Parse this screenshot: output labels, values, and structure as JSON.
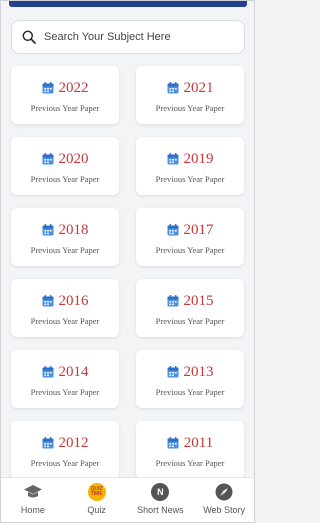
{
  "top_strip_color": "#21408e",
  "search": {
    "placeholder": "Search Your Subject Here"
  },
  "papers": [
    {
      "year": "2022",
      "subtitle": "Previous Year Paper"
    },
    {
      "year": "2021",
      "subtitle": "Previous Year Paper"
    },
    {
      "year": "2020",
      "subtitle": "Previous Year Paper"
    },
    {
      "year": "2019",
      "subtitle": "Previous Year Paper"
    },
    {
      "year": "2018",
      "subtitle": "Previous Year Paper"
    },
    {
      "year": "2017",
      "subtitle": "Previous Year Paper"
    },
    {
      "year": "2016",
      "subtitle": "Previous Year Paper"
    },
    {
      "year": "2015",
      "subtitle": "Previous Year Paper"
    },
    {
      "year": "2014",
      "subtitle": "Previous Year Paper"
    },
    {
      "year": "2013",
      "subtitle": "Previous Year Paper"
    },
    {
      "year": "2012",
      "subtitle": "Previous Year Paper"
    },
    {
      "year": "2011",
      "subtitle": "Previous Year Paper"
    }
  ],
  "colors": {
    "year_text": "#c8373a",
    "calendar_icon": "#4a90e2",
    "quiz_badge": "#f4b400"
  },
  "bottom_nav": [
    {
      "label": "Home",
      "icon": "graduation-cap-icon"
    },
    {
      "label": "Quiz",
      "icon": "quiz-time-icon",
      "badge_text": "QUIZ TIME"
    },
    {
      "label": "Short News",
      "icon": "news-n-icon",
      "badge_text": "N"
    },
    {
      "label": "Web Story",
      "icon": "compass-icon"
    }
  ]
}
